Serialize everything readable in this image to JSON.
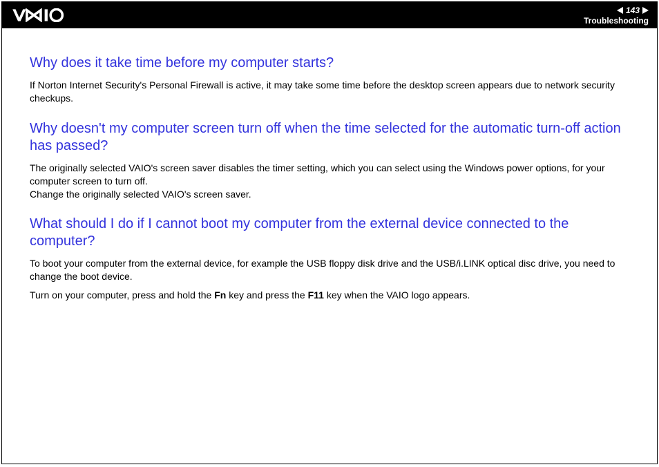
{
  "header": {
    "page_number": "143",
    "section": "Troubleshooting"
  },
  "sections": [
    {
      "question": "Why does it take time before my computer starts?",
      "paragraphs": [
        "If Norton Internet Security's Personal Firewall is active, it may take some time before the desktop screen appears due to network security checkups."
      ]
    },
    {
      "question": "Why doesn't my computer screen turn off when the time selected for the automatic turn-off action has passed?",
      "paragraphs": [
        "The originally selected VAIO's screen saver disables the timer setting, which you can select using the Windows power options, for your computer screen to turn off.\nChange the originally selected VAIO's screen saver."
      ]
    },
    {
      "question": "What should I do if I cannot boot my computer from the external device connected to the computer?",
      "paragraphs": [
        "To boot your computer from the external device, for example the USB floppy disk drive and the USB/i.LINK optical disc drive, you need to change the boot device."
      ]
    }
  ],
  "last_para_prefix": "Turn on your computer, press and hold the ",
  "fn_key": "Fn",
  "last_para_mid": " key and press the ",
  "f11_key": "F11",
  "last_para_suffix": " key when the VAIO logo appears."
}
